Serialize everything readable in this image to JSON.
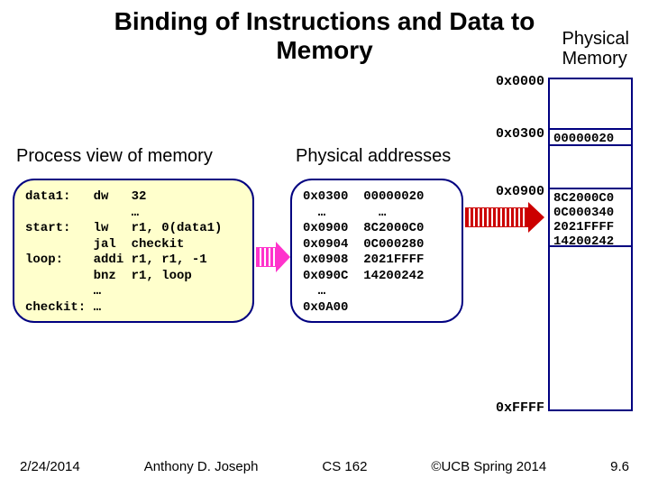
{
  "title_line1": "Binding of Instructions and Data to",
  "title_line2": "Memory",
  "physical_memory_label_l1": "Physical",
  "physical_memory_label_l2": "Memory",
  "heading_process": "Process view of memory",
  "heading_phys": "Physical addresses",
  "addr_labels": {
    "a0000": "0x0000",
    "a0300": "0x0300",
    "a0900": "0x0900",
    "affff": "0xFFFF"
  },
  "mem_contents": {
    "cell0300": "00000020",
    "cell0900_l1": "8C2000C0",
    "cell0900_l2": "0C000340",
    "cell0900_l3": "2021FFFF",
    "cell0900_l4": "14200242"
  },
  "code_lines": {
    "l1": "data1:   dw   32",
    "l2": "              …",
    "l3": "start:   lw   r1, 0(data1)",
    "l4": "         jal  checkit",
    "l5": "loop:    addi r1, r1, -1",
    "l6": "         bnz  r1, loop",
    "l7": "         …",
    "l8": "checkit: …"
  },
  "phys_lines": {
    "l1": "0x0300  00000020",
    "l2": "  …       …",
    "l3": "0x0900  8C2000C0",
    "l4": "0x0904  0C000280",
    "l5": "0x0908  2021FFFF",
    "l6": "0x090C  14200242",
    "l7": "  …",
    "l8": "0x0A00"
  },
  "footer": {
    "date": "2/24/2014",
    "author": "Anthony D. Joseph",
    "course": "CS 162",
    "copyright": "©UCB Spring 2014",
    "page": "9.6"
  }
}
